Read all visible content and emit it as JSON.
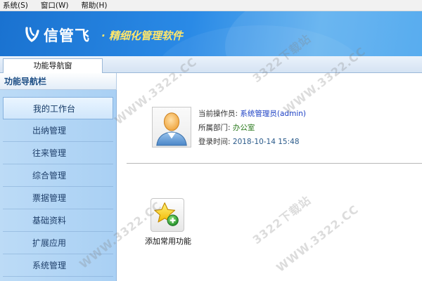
{
  "menubar": {
    "items": [
      {
        "label": "系统(S)"
      },
      {
        "label": "窗口(W)"
      },
      {
        "label": "帮助(H)"
      }
    ]
  },
  "banner": {
    "brand": "信管飞",
    "slogan": "· 精细化管理软件"
  },
  "tabs": [
    {
      "label": "功能导航窗"
    }
  ],
  "sidebar": {
    "title": "功能导航栏",
    "items": [
      {
        "label": "我的工作台",
        "active": true
      },
      {
        "label": "出纳管理"
      },
      {
        "label": "往来管理"
      },
      {
        "label": "综合管理"
      },
      {
        "label": "票据管理"
      },
      {
        "label": "基础资料"
      },
      {
        "label": "扩展应用"
      },
      {
        "label": "系统管理"
      }
    ]
  },
  "user_info": {
    "operator_label": "当前操作员:",
    "operator_value": "系统管理员(admin)",
    "dept_label": "所属部门:",
    "dept_value": "办公室",
    "login_label": "登录时间:",
    "login_value": "2018-10-14 15:48"
  },
  "shortcut": {
    "label": "添加常用功能",
    "icon": "star-add-icon"
  },
  "watermark": {
    "text1": "3322下载站",
    "text2": "WWW.3322.CC"
  },
  "colors": {
    "banner_blue": "#2a8ae6",
    "slogan_yellow": "#ffe66a",
    "sidebar_blue": "#b4d6f5",
    "operator_blue": "#1b3fc4",
    "dept_green": "#2a7a1d"
  }
}
